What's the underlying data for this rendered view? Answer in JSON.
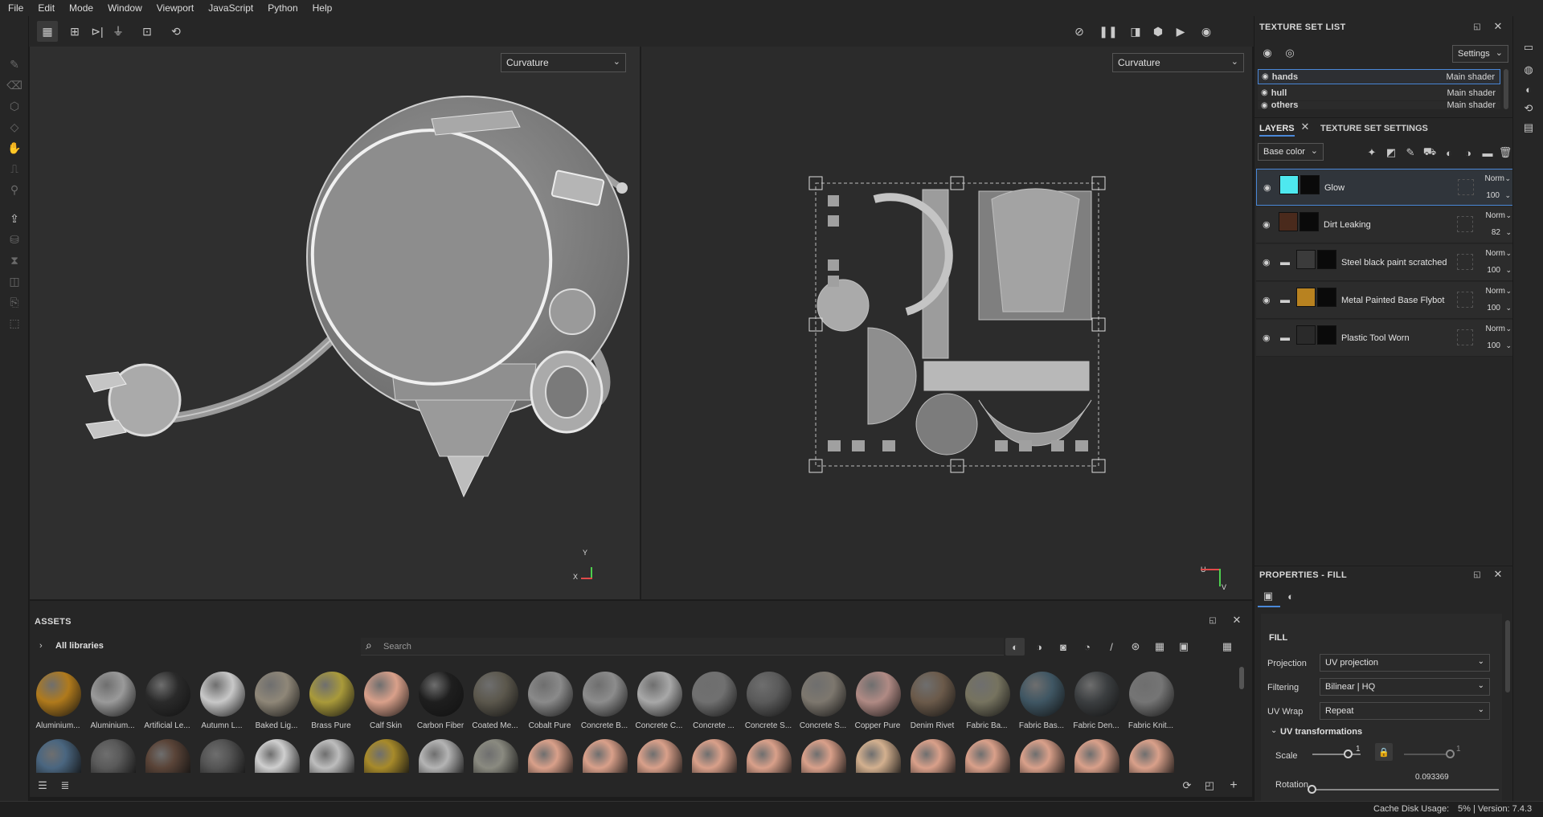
{
  "menu": [
    "File",
    "Edit",
    "Mode",
    "Window",
    "Viewport",
    "JavaScript",
    "Python",
    "Help"
  ],
  "viewport3d": {
    "channel": "Curvature",
    "axis_y": "Y",
    "axis_x": "X"
  },
  "viewport2d": {
    "channel": "Curvature",
    "axis_u": "U",
    "axis_v": "V"
  },
  "texture_set_list": {
    "title": "TEXTURE SET LIST",
    "settings_label": "Settings",
    "rows": [
      {
        "name": "hands",
        "shader": "Main shader"
      },
      {
        "name": "hull",
        "shader": "Main shader"
      },
      {
        "name": "others",
        "shader": "Main shader"
      }
    ]
  },
  "layers": {
    "tab_layers": "LAYERS",
    "tab_texture_settings": "TEXTURE SET SETTINGS",
    "channel": "Base color",
    "rows": [
      {
        "name": "Glow",
        "blend": "Norm",
        "opacity": "100",
        "color": "#4ee8ef"
      },
      {
        "name": "Dirt Leaking",
        "blend": "Norm",
        "opacity": "82",
        "color": "#4a2a1c"
      },
      {
        "name": "Steel black paint scratched",
        "blend": "Norm",
        "opacity": "100",
        "color": "#3b3b3b"
      },
      {
        "name": "Metal Painted Base Flybot",
        "blend": "Norm",
        "opacity": "100",
        "color": "#b88220"
      },
      {
        "name": "Plastic Tool Worn",
        "blend": "Norm",
        "opacity": "100",
        "color": "#2a2a2a"
      }
    ]
  },
  "properties": {
    "title": "PROPERTIES - FILL",
    "section": "FILL",
    "projection_label": "Projection",
    "projection_value": "UV projection",
    "filtering_label": "Filtering",
    "filtering_value": "Bilinear | HQ",
    "uvwrap_label": "UV Wrap",
    "uvwrap_value": "Repeat",
    "uv_transform_label": "UV transformations",
    "scale_label": "Scale",
    "scale_value": "1",
    "scale_value2": "1",
    "rotation_label": "Rotation",
    "rotation_value": "0.093369"
  },
  "assets": {
    "title": "ASSETS",
    "library": "All libraries",
    "search_placeholder": "Search",
    "materials": [
      {
        "label": "Aluminium...",
        "color": "#b07a1c"
      },
      {
        "label": "Aluminium...",
        "color": "#9a9a9a"
      },
      {
        "label": "Artificial Le...",
        "color": "#2a2a2a"
      },
      {
        "label": "Autumn L...",
        "color": "#c8c8c8"
      },
      {
        "label": "Baked Lig...",
        "color": "#8f8778"
      },
      {
        "label": "Brass Pure",
        "color": "#a99a3a"
      },
      {
        "label": "Calf Skin",
        "color": "#d9a08a"
      },
      {
        "label": "Carbon Fiber",
        "color": "#1e1e1e"
      },
      {
        "label": "Coated Me...",
        "color": "#5b574c"
      },
      {
        "label": "Cobalt Pure",
        "color": "#8a8a8a"
      },
      {
        "label": "Concrete B...",
        "color": "#8c8c8c"
      },
      {
        "label": "Concrete C...",
        "color": "#a8a8a8"
      },
      {
        "label": "Concrete ...",
        "color": "#707070"
      },
      {
        "label": "Concrete S...",
        "color": "#5a5a5a"
      },
      {
        "label": "Concrete S...",
        "color": "#7d776e"
      },
      {
        "label": "Copper Pure",
        "color": "#b08a84"
      },
      {
        "label": "Denim Rivet",
        "color": "#6b5a4a"
      },
      {
        "label": "Fabric Ba...",
        "color": "#76735f"
      },
      {
        "label": "Fabric Bas...",
        "color": "#3f5663"
      },
      {
        "label": "Fabric Den...",
        "color": "#3b3e40"
      },
      {
        "label": "Fabric Knit...",
        "color": "#757575"
      }
    ],
    "row2_colors": [
      "#4a6680",
      "#5a5a5a",
      "#5a4438",
      "#555555",
      "#cfcfcf",
      "#bdbdbd",
      "#a78a2a",
      "#b4b4b4",
      "#8a8a80",
      "#d9a08a",
      "#d9a08a",
      "#d9a08a",
      "#d9a08a",
      "#d9a08a",
      "#d9a08a",
      "#d3b08f",
      "#d9a08a",
      "#d9a08a",
      "#d9a08a",
      "#d9a08a",
      "#d9a08a"
    ]
  },
  "status": {
    "cache": "Cache Disk Usage:",
    "version": "5% | Version: 7.4.3"
  }
}
